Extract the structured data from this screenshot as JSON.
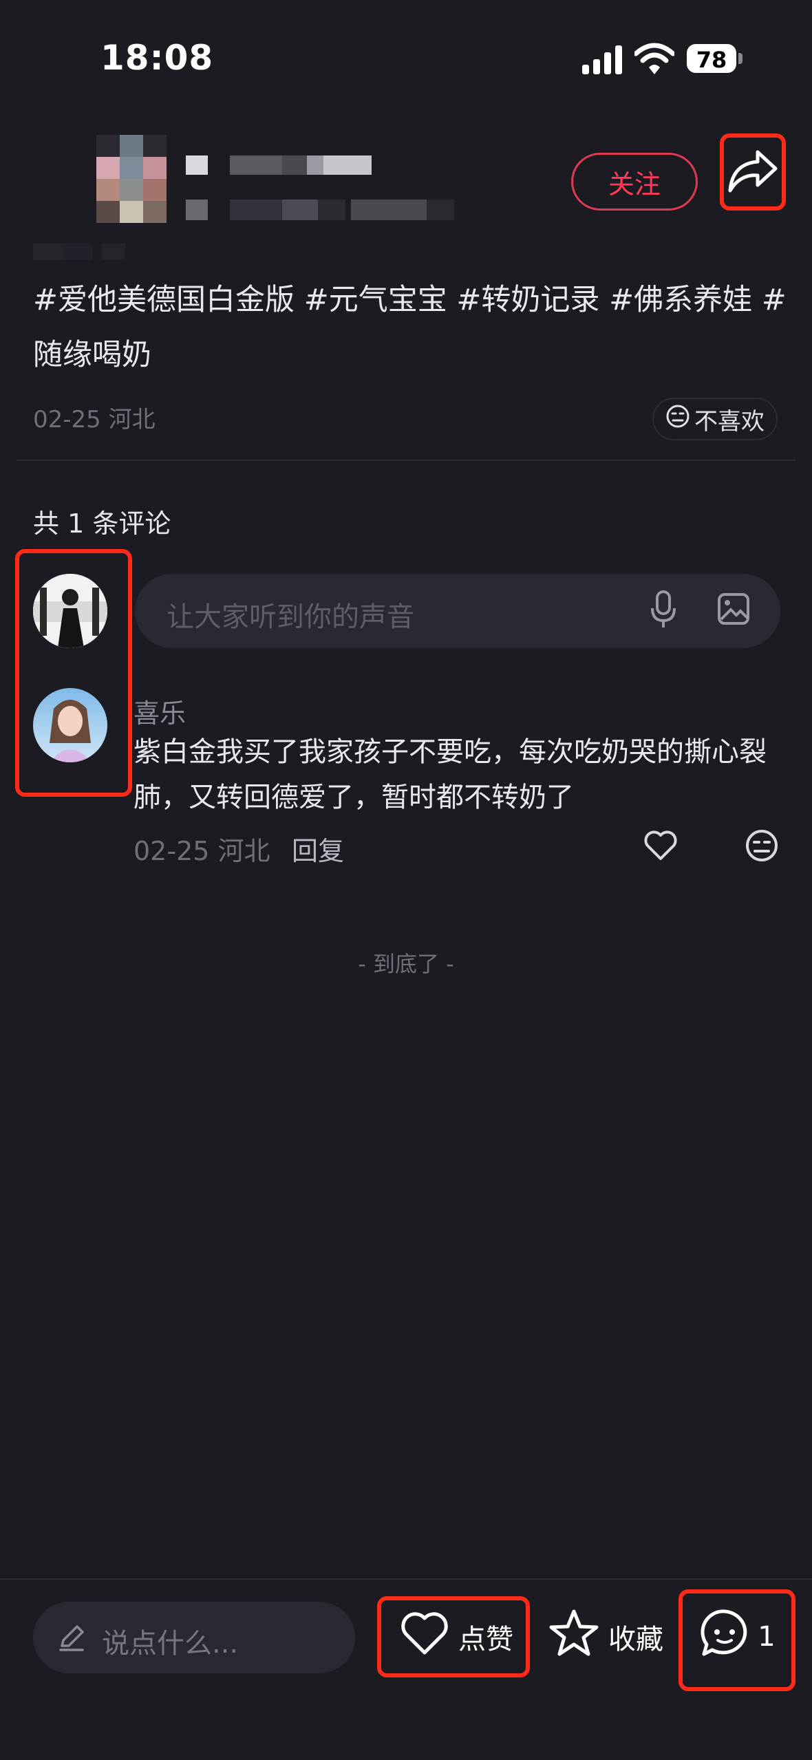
{
  "status_bar": {
    "time": "18:08",
    "battery": "78"
  },
  "header": {
    "follow_label": "关注"
  },
  "post": {
    "hashtags": "#爱他美德国白金版 #元气宝宝 #转奶记录 #佛系养娃 #随缘喝奶",
    "meta": "02-25 河北",
    "dislike_label": "不喜欢"
  },
  "comments": {
    "count_label": "共 1 条评论",
    "input_placeholder": "让大家听到你的声音",
    "items": [
      {
        "user": "喜乐",
        "text": "紫白金我买了我家孩子不要吃，每次吃奶哭的撕心裂肺，又转回德爱了，暂时都不转奶了",
        "meta": "02-25 河北",
        "reply_label": "回复"
      }
    ],
    "end_label": "- 到底了 -"
  },
  "bottom_bar": {
    "say_placeholder": "说点什么...",
    "like_label": "点赞",
    "favorite_label": "收藏",
    "comment_count": "1"
  },
  "colors": {
    "accent": "#ff3b57",
    "background": "#1c1b22",
    "highlight_box": "#ff2a18"
  }
}
